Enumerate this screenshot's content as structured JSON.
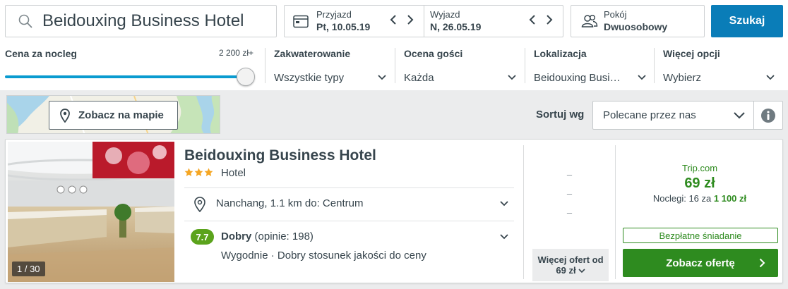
{
  "search": {
    "query": "Beidouxing Business Hotel"
  },
  "dates": {
    "checkin_label": "Przyjazd",
    "checkin_value": "Pt, 10.05.19",
    "checkout_label": "Wyjazd",
    "checkout_value": "N, 26.05.19"
  },
  "room": {
    "label": "Pokój",
    "value": "Dwuosobowy"
  },
  "search_button": "Szukaj",
  "filters": {
    "price": {
      "label": "Cena za nocleg",
      "max": "2 200 zł+",
      "level": 1.0
    },
    "accommodation": {
      "label": "Zakwaterowanie",
      "value": "Wszystkie typy"
    },
    "guest_rating": {
      "label": "Ocena gości",
      "value": "Każda"
    },
    "location": {
      "label": "Lokalizacja",
      "value": "Beidouxing Busi…"
    },
    "more": {
      "label": "Więcej opcji",
      "value": "Wybierz"
    }
  },
  "map": {
    "button_label": "Zobacz na mapie"
  },
  "sort": {
    "label": "Sortuj wg",
    "value": "Polecane przez nas"
  },
  "hotel": {
    "name": "Beidouxing Business Hotel",
    "stars": 3,
    "type": "Hotel",
    "photo_count": "1 / 30",
    "location": "Nanchang, 1.1 km do: Centrum",
    "rating_score": "7.7",
    "rating_word": "Dobry",
    "rating_count": "(opinie: 198)",
    "rating_tags": "Wygodnie · Dobry stosunek jakości do ceny",
    "alt_prices": [
      "–",
      "–",
      "–"
    ],
    "more_offers_line1": "Więcej ofert od",
    "more_offers_line2": "69 zł",
    "deal": {
      "provider": "Trip.com",
      "price": "69 zł",
      "nights_prefix": "Noclegi: 16 za",
      "nights_total": "1 100 zł",
      "breakfast": "Bezpłatne śniadanie",
      "button": "Zobacz ofertę"
    }
  },
  "colors": {
    "primary_blue": "#0a7db8",
    "deal_green": "#2e8b1f",
    "rating_green": "#5ba31c",
    "star_yellow": "#f5a623",
    "text": "#37454d"
  }
}
